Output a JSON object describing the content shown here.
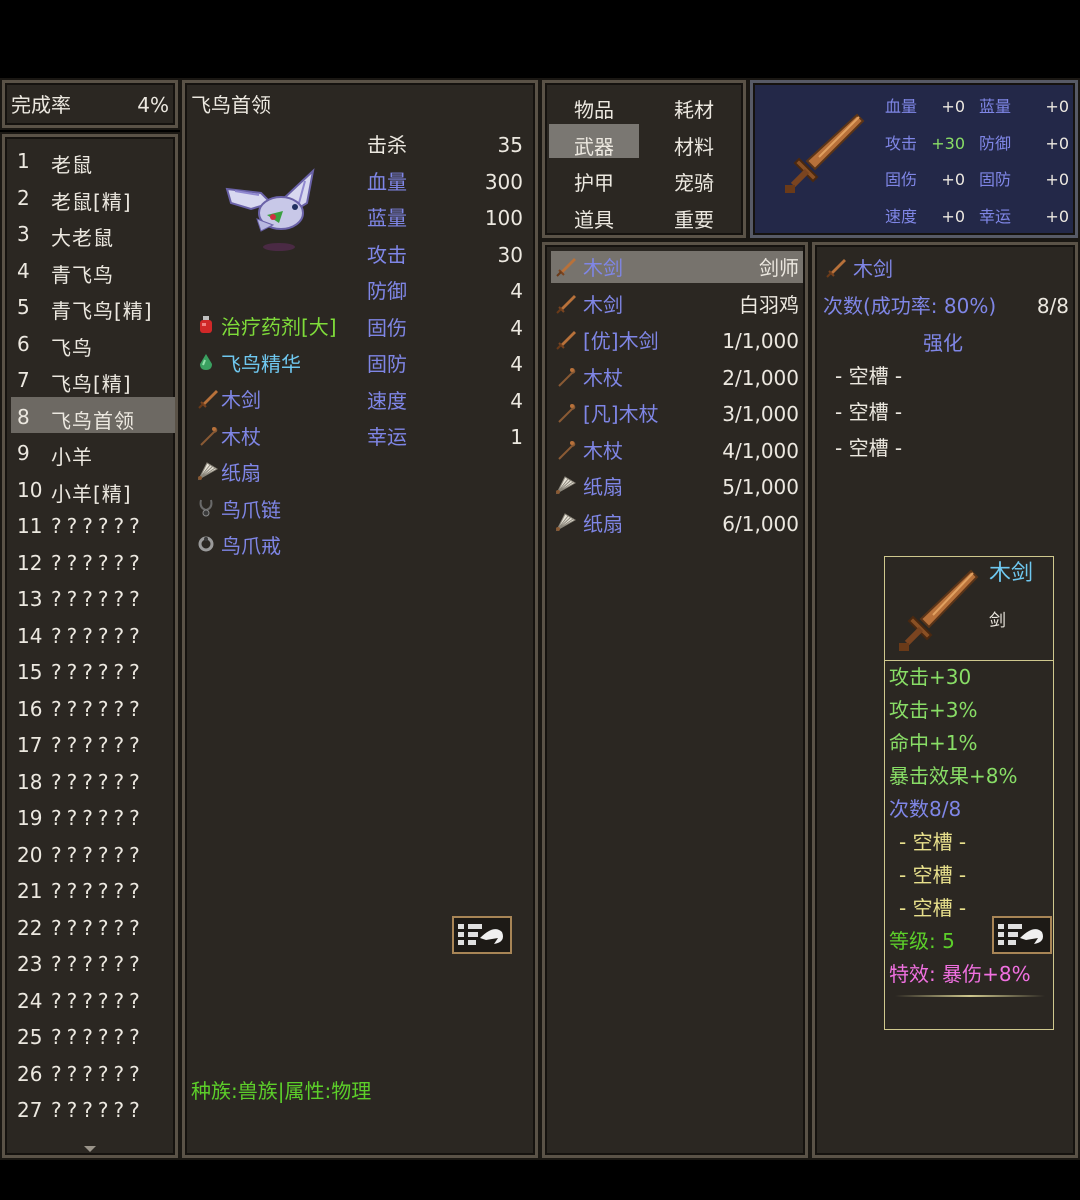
{
  "completion": {
    "label": "完成率",
    "value": "4%"
  },
  "monsters": [
    {
      "num": "1",
      "name": "老鼠"
    },
    {
      "num": "2",
      "name": "老鼠[精]"
    },
    {
      "num": "3",
      "name": "大老鼠"
    },
    {
      "num": "4",
      "name": "青飞鸟"
    },
    {
      "num": "5",
      "name": "青飞鸟[精]"
    },
    {
      "num": "6",
      "name": "飞鸟"
    },
    {
      "num": "7",
      "name": "飞鸟[精]"
    },
    {
      "num": "8",
      "name": "飞鸟首领"
    },
    {
      "num": "9",
      "name": "小羊"
    },
    {
      "num": "10",
      "name": "小羊[精]"
    },
    {
      "num": "11",
      "name": "??????"
    },
    {
      "num": "12",
      "name": "??????"
    },
    {
      "num": "13",
      "name": "??????"
    },
    {
      "num": "14",
      "name": "??????"
    },
    {
      "num": "15",
      "name": "??????"
    },
    {
      "num": "16",
      "name": "??????"
    },
    {
      "num": "17",
      "name": "??????"
    },
    {
      "num": "18",
      "name": "??????"
    },
    {
      "num": "19",
      "name": "??????"
    },
    {
      "num": "20",
      "name": "??????"
    },
    {
      "num": "21",
      "name": "??????"
    },
    {
      "num": "22",
      "name": "??????"
    },
    {
      "num": "23",
      "name": "??????"
    },
    {
      "num": "24",
      "name": "??????"
    },
    {
      "num": "25",
      "name": "??????"
    },
    {
      "num": "26",
      "name": "??????"
    },
    {
      "num": "27",
      "name": "??????"
    }
  ],
  "detail": {
    "title": "飞鸟首领",
    "stats": [
      {
        "label": "击杀",
        "value": "35"
      },
      {
        "label": "血量",
        "value": "300"
      },
      {
        "label": "蓝量",
        "value": "100"
      },
      {
        "label": "攻击",
        "value": "30"
      },
      {
        "label": "防御",
        "value": "4"
      },
      {
        "label": "固伤",
        "value": "4"
      },
      {
        "label": "固防",
        "value": "4"
      },
      {
        "label": "速度",
        "value": "4"
      },
      {
        "label": "幸运",
        "value": "1"
      }
    ],
    "drops": [
      {
        "name": "治疗药剂[大]",
        "icon": "potion-icon"
      },
      {
        "name": "飞鸟精华",
        "icon": "essence-icon"
      },
      {
        "name": "木剑",
        "icon": "sword-icon"
      },
      {
        "name": "木杖",
        "icon": "staff-icon"
      },
      {
        "name": "纸扇",
        "icon": "fan-icon"
      },
      {
        "name": "鸟爪链",
        "icon": "necklace-icon"
      },
      {
        "name": "鸟爪戒",
        "icon": "ring-icon"
      }
    ],
    "race": "种族:兽族|属性:物理"
  },
  "tabs": [
    {
      "label": "物品"
    },
    {
      "label": "耗材"
    },
    {
      "label": "武器"
    },
    {
      "label": "材料"
    },
    {
      "label": "护甲"
    },
    {
      "label": "宠骑"
    },
    {
      "label": "道具"
    },
    {
      "label": "重要"
    }
  ],
  "stat_panel": [
    {
      "l1": "血量",
      "v1": "+0",
      "l2": "蓝量",
      "v2": "+0"
    },
    {
      "l1": "攻击",
      "v1": "+30",
      "l2": "防御",
      "v2": "+0"
    },
    {
      "l1": "固伤",
      "v1": "+0",
      "l2": "固防",
      "v2": "+0"
    },
    {
      "l1": "速度",
      "v1": "+0",
      "l2": "幸运",
      "v2": "+0"
    }
  ],
  "items": [
    {
      "name": "木剑",
      "right": "剑师",
      "icon": "sword-icon"
    },
    {
      "name": "木剑",
      "right": "白羽鸡",
      "icon": "sword-icon"
    },
    {
      "name": "[优]木剑",
      "right": "1/1,000",
      "icon": "sword-icon"
    },
    {
      "name": "木杖",
      "right": "2/1,000",
      "icon": "staff-icon"
    },
    {
      "name": "[凡]木杖",
      "right": "3/1,000",
      "icon": "staff-icon"
    },
    {
      "name": "木杖",
      "right": "4/1,000",
      "icon": "staff-icon"
    },
    {
      "name": "纸扇",
      "right": "5/1,000",
      "icon": "fan-icon"
    },
    {
      "name": "纸扇",
      "right": "6/1,000",
      "icon": "fan-icon"
    }
  ],
  "info": {
    "name": "木剑",
    "count_label": "次数(成功率: 80%)",
    "count_value": "8/8",
    "enhance": "强化",
    "slots": [
      "- 空槽 -",
      "- 空槽 -",
      "- 空槽 -"
    ]
  },
  "tooltip": {
    "name": "木剑",
    "type": "剑",
    "lines": [
      "攻击+30",
      "攻击+3%",
      "命中+1%",
      "暴击效果+8%",
      "次数8/8"
    ],
    "slots": [
      "- 空槽 -",
      "- 空槽 -",
      "- 空槽 -"
    ],
    "level": "等级: 5",
    "special": "特效: 暴伤+8%"
  }
}
